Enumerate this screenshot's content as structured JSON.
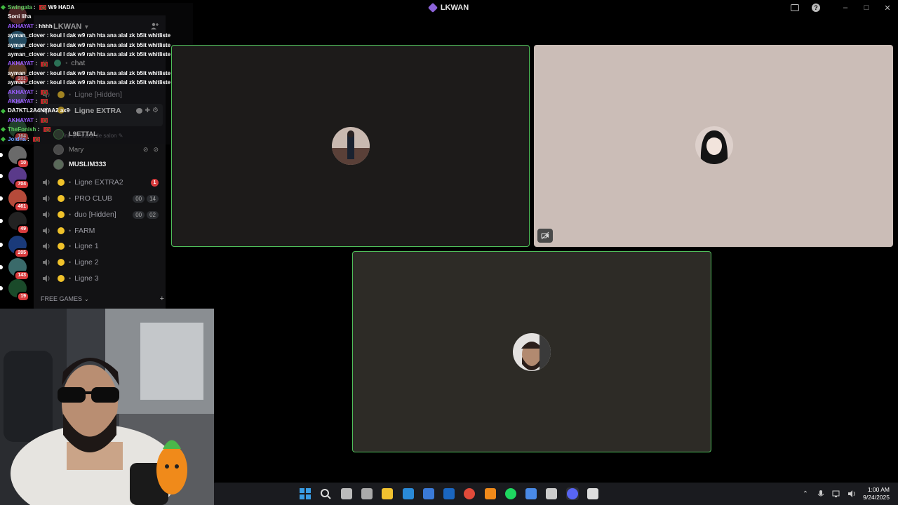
{
  "window": {
    "title": "LKWAN",
    "controls": [
      "screen-share-icon",
      "help-icon",
      "minimize-icon",
      "maximize-icon",
      "close-icon"
    ]
  },
  "servers": [
    {
      "badge": "",
      "color": "#6b3030"
    },
    {
      "badge": "",
      "color": "#2d6a8a"
    },
    {
      "badge": "201",
      "color": "#7a4a2a"
    },
    {
      "badge": "",
      "color": "#4a4a6a"
    },
    {
      "badge": "164",
      "color": "#2a5a3a"
    },
    {
      "badge": "10",
      "color": "#6a6a6a"
    },
    {
      "badge": "704",
      "color": "#5a3a8a"
    },
    {
      "badge": "461",
      "color": "#b54a3a"
    },
    {
      "badge": "49",
      "color": "#222222"
    },
    {
      "badge": "205",
      "color": "#1a3a7a"
    },
    {
      "badge": "143",
      "color": "#3a6a6a"
    },
    {
      "badge": "19",
      "color": "#1a4a2a"
    }
  ],
  "sidebar": {
    "server_name": "LKWAN",
    "channels": [
      {
        "name": "chat",
        "type": "text"
      },
      {
        "name": "Ligne [Hidden]",
        "type": "voice"
      },
      {
        "name": "Ligne EXTRA",
        "type": "voice",
        "active": true,
        "status_placeholder": "Définir un statut de salon"
      },
      {
        "name": "Ligne EXTRA2",
        "type": "voice",
        "badge": "1"
      },
      {
        "name": "PRO CLUB",
        "type": "voice",
        "pills": [
          "00",
          "14"
        ]
      },
      {
        "name": "duo [Hidden]",
        "type": "voice",
        "pills": [
          "00",
          "02"
        ]
      },
      {
        "name": "FARM",
        "type": "voice"
      },
      {
        "name": "Ligne 1",
        "type": "voice"
      },
      {
        "name": "Ligne 2",
        "type": "voice"
      },
      {
        "name": "Ligne 3",
        "type": "voice"
      }
    ],
    "voice_users": [
      {
        "name": "L9ETTAL",
        "muted": false
      },
      {
        "name": "Mary",
        "muted": true
      },
      {
        "name": "MUSLIM333",
        "muted": false
      }
    ],
    "category": "FREE GAMES"
  },
  "chat": [
    {
      "user": "Swingala",
      "color": "gr",
      "text": "W9 HADA",
      "flag": true,
      "gem": true
    },
    {
      "user": "",
      "color": "wh",
      "text": "Soni liha",
      "flag": false,
      "gem": false
    },
    {
      "user": "AKHAYAT",
      "color": "u",
      "text": "hhhh",
      "flag": false,
      "gem": false
    },
    {
      "user": "ayman_clover",
      "color": "wh",
      "text": "koul l dak w9 rah hta ana alal zk b5it whitliste",
      "flag": false,
      "gem": false
    },
    {
      "user": "ayman_clover",
      "color": "wh",
      "text": "koul l dak w9 rah hta ana alal zk b5it whitliste",
      "flag": false,
      "gem": false
    },
    {
      "user": "ayman_clover",
      "color": "wh",
      "text": "koul l dak w9 rah hta ana alal zk b5it whitliste",
      "flag": false,
      "gem": false
    },
    {
      "user": "AKHAYAT",
      "color": "u",
      "text": "",
      "flag": true,
      "gem": false
    },
    {
      "user": "ayman_clover",
      "color": "wh",
      "text": "koul l dak w9 rah hta ana alal zk b5it whitliste",
      "flag": false,
      "gem": false
    },
    {
      "user": "ayman_clover",
      "color": "wh",
      "text": "koul l dak w9 rah hta ana alal zk b5it whitliste",
      "flag": false,
      "gem": false
    },
    {
      "user": "AKHAYAT",
      "color": "u",
      "text": "",
      "flag": true,
      "gem": false
    },
    {
      "user": "AKHAYAT",
      "color": "u",
      "text": "",
      "flag": true,
      "gem": false
    },
    {
      "user": "",
      "color": "wh",
      "text": "DA7KTL2A4NYAA2 ax9",
      "flag": false,
      "gem": true
    },
    {
      "user": "AKHAYAT",
      "color": "u",
      "text": "",
      "flag": true,
      "gem": false
    },
    {
      "user": "TheFonish",
      "color": "gr",
      "text": "",
      "flag": true,
      "gem": true
    },
    {
      "user": "Joidna",
      "color": "bl",
      "text": "",
      "flag": true,
      "gem": true
    }
  ],
  "tiles": [
    {
      "name": "tile-1",
      "speaking": true
    },
    {
      "name": "tile-2",
      "speaking": false
    },
    {
      "name": "tile-3",
      "speaking": true
    }
  ],
  "taskbar": {
    "apps": [
      "windows-start-icon",
      "search-icon",
      "task-view-icon",
      "settings-icon",
      "file-explorer-icon",
      "edge-icon",
      "store-icon",
      "outlook-icon",
      "chrome-icon",
      "app-orange-icon",
      "spotify-icon",
      "app-blue-icon",
      "app-clock-icon",
      "discord-icon",
      "app-tray-icon"
    ],
    "time": "1:00 AM",
    "date": "9/24/2025"
  }
}
